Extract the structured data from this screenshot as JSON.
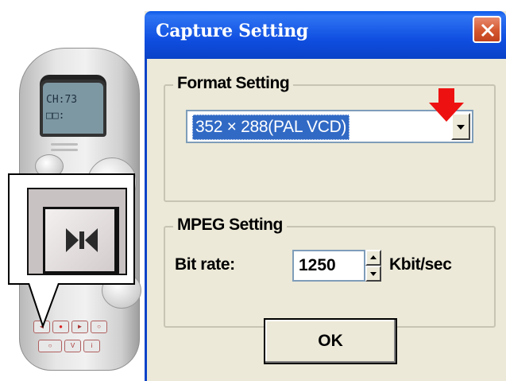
{
  "remote": {
    "display_line1": "CH:73",
    "display_line2": "□□:"
  },
  "dialog": {
    "title": "Capture Setting",
    "format_group": {
      "label": "Format Setting",
      "selected_value": "352 × 288(PAL VCD)"
    },
    "mpeg_group": {
      "label": "MPEG Setting",
      "bit_rate_label": "Bit rate:",
      "bit_rate_value": "1250",
      "unit": "Kbit/sec"
    },
    "ok_label": "OK"
  },
  "colors": {
    "titlebar": "#0a4fe0",
    "dialog_bg": "#ece9d8",
    "selection": "#316ac5",
    "red_arrow": "#ee1111",
    "close_button": "#d4572f"
  },
  "icons": [
    "close-icon",
    "dropdown-arrow-icon",
    "spin-up-icon",
    "spin-down-icon",
    "red-pointer-arrow-icon",
    "bowtie-icon"
  ]
}
